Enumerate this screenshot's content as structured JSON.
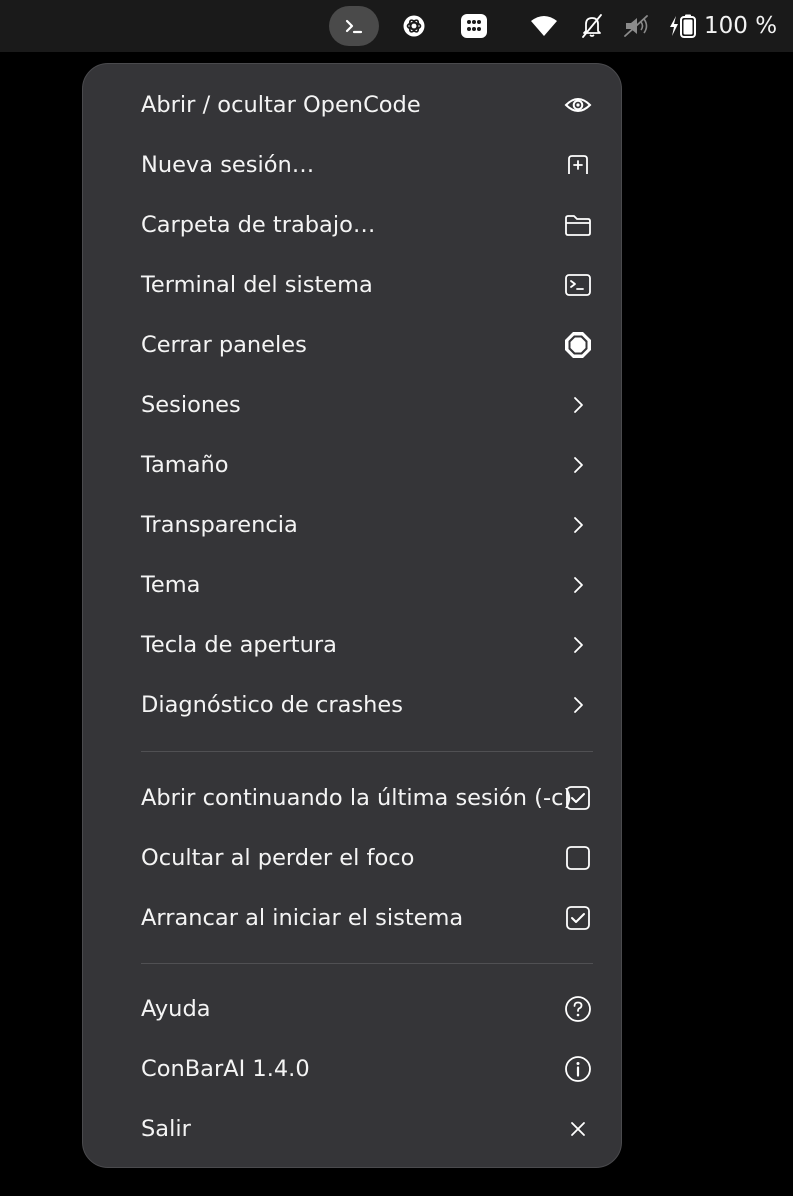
{
  "topbar": {
    "battery_label": "100 %",
    "tray_icons": [
      "terminal-icon",
      "openai-icon",
      "dots-app-icon",
      "wifi-icon",
      "bell-muted-icon",
      "speaker-muted-icon",
      "battery-charging-icon"
    ]
  },
  "menu": {
    "items": [
      {
        "label": "Abrir / ocultar OpenCode",
        "icon": "eye-icon"
      },
      {
        "label": "Nueva sesión…",
        "icon": "new-session-icon"
      },
      {
        "label": "Carpeta de trabajo…",
        "icon": "folder-icon"
      },
      {
        "label": "Terminal del sistema",
        "icon": "terminal-icon"
      },
      {
        "label": "Cerrar paneles",
        "icon": "stop-icon"
      },
      {
        "label": "Sesiones",
        "icon": "chevron-right-icon"
      },
      {
        "label": "Tamaño",
        "icon": "chevron-right-icon"
      },
      {
        "label": "Transparencia",
        "icon": "chevron-right-icon"
      },
      {
        "label": "Tema",
        "icon": "chevron-right-icon"
      },
      {
        "label": "Tecla de apertura",
        "icon": "chevron-right-icon"
      },
      {
        "label": "Diagnóstico de crashes",
        "icon": "chevron-right-icon"
      }
    ],
    "toggles": [
      {
        "label": "Abrir continuando la última sesión (-c)",
        "checked": true
      },
      {
        "label": "Ocultar al perder el foco",
        "checked": false
      },
      {
        "label": "Arrancar al iniciar el sistema",
        "checked": true
      }
    ],
    "footer": [
      {
        "label": "Ayuda",
        "icon": "help-icon"
      },
      {
        "label": "ConBarAI 1.4.0",
        "icon": "info-icon"
      },
      {
        "label": "Salir",
        "icon": "close-icon"
      }
    ]
  },
  "colors": {
    "menu_bg": "#353538",
    "topbar_bg": "#1a1a1a",
    "text": "#f4f4f4"
  }
}
